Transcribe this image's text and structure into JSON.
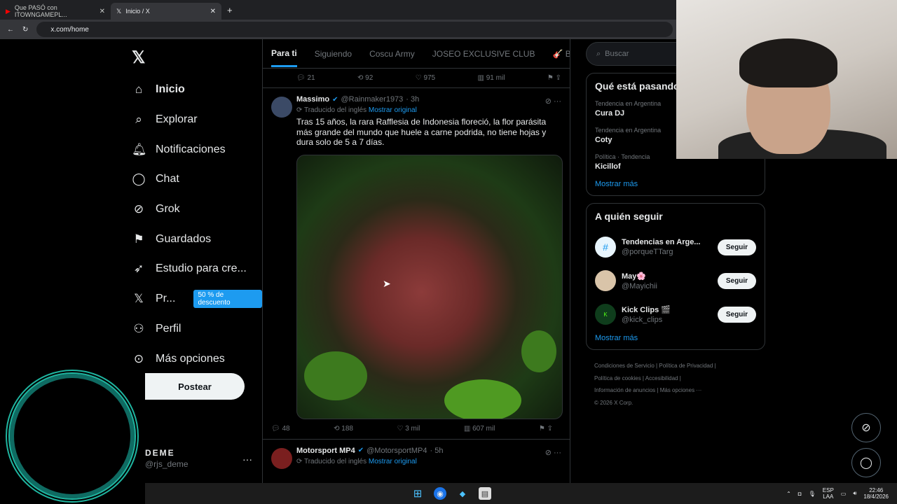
{
  "browser": {
    "tabs": [
      {
        "label": "Que PASÓ con ITOWNGAMEPL..."
      },
      {
        "label": "Inicio / X"
      }
    ],
    "url": "x.com/home"
  },
  "nav": {
    "items": [
      {
        "label": "Inicio"
      },
      {
        "label": "Explorar"
      },
      {
        "label": "Notificaciones"
      },
      {
        "label": "Chat"
      },
      {
        "label": "Grok"
      },
      {
        "label": "Guardados"
      },
      {
        "label": "Estudio para cre..."
      },
      {
        "label": "Pr..."
      },
      {
        "label": "Perfil"
      },
      {
        "label": "Más opciones"
      }
    ],
    "premium_badge": "50 % de descuento",
    "post_button": "Postear",
    "account": {
      "name": "DEME",
      "handle": "@rjs_deme"
    }
  },
  "feed": {
    "tabs": [
      "Para ti",
      "Siguiendo",
      "Coscu Army",
      "JOSEO EXCLUSIVE CLUB",
      "🎸 BAULO C"
    ],
    "prev_actions": {
      "replies": "21",
      "reposts": "92",
      "likes": "975",
      "views": "91 mil"
    },
    "tweet1": {
      "name": "Massimo",
      "handle": "@Rainmaker1973",
      "time": "· 3h",
      "translated": "Traducido del inglés",
      "show_original": "Mostrar original",
      "text": "Tras 15 años, la rara Rafflesia de Indonesia floreció, la flor parásita más grande del mundo que huele a carne podrida, no tiene hojas y dura solo de 5 a 7 días.",
      "replies": "48",
      "reposts": "188",
      "likes": "3 mil",
      "views": "607 mil"
    },
    "tweet2": {
      "name": "Motorsport MP4",
      "handle": "@MotorsportMP4",
      "time": "· 5h",
      "translated": "Traducido del inglés",
      "show_original": "Mostrar original"
    }
  },
  "sidebar": {
    "search_placeholder": "Buscar",
    "trends_title": "Qué está pasando",
    "trends": [
      {
        "context": "Tendencia en Argentina",
        "topic": "Cura DJ"
      },
      {
        "context": "Tendencia en Argentina",
        "topic": "Coty"
      },
      {
        "context": "Política · Tendencia",
        "topic": "Kicillof"
      }
    ],
    "show_more": "Mostrar más",
    "follow_title": "A quién seguir",
    "follow": [
      {
        "name": "Tendencias en Arge...",
        "handle": "@porqueTTarg",
        "button": "Seguir"
      },
      {
        "name": "May🌸",
        "handle": "@Mayichii",
        "button": "Seguir"
      },
      {
        "name": "Kick Clips 🎬",
        "handle": "@kick_clips",
        "button": "Seguir"
      }
    ],
    "footer": {
      "terms": "Condiciones de Servicio",
      "privacy": "Política de Privacidad",
      "cookies": "Política de cookies",
      "accessibility": "Accesibilidad",
      "ads": "Información de anuncios",
      "more": "Más opciones ···",
      "copyright": "© 2026 X Corp."
    }
  },
  "taskbar": {
    "lang1": "ESP",
    "lang2": "LAA",
    "time": "22:46",
    "date": "18/4/2026"
  }
}
